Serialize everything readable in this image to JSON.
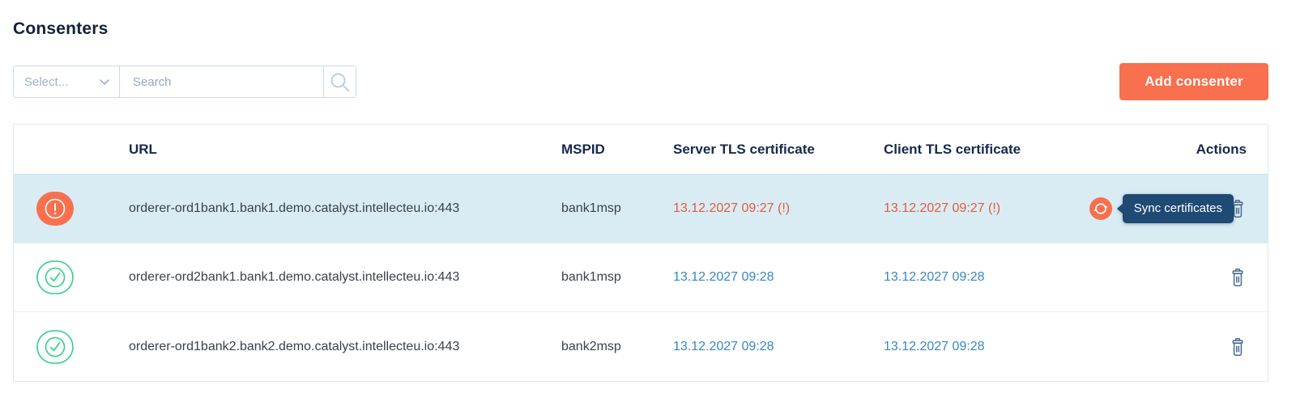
{
  "page": {
    "title": "Consenters"
  },
  "toolbar": {
    "select_value": "Select...",
    "search_placeholder": "Search",
    "add_button": "Add consenter"
  },
  "table": {
    "columns": {
      "url": "URL",
      "mspid": "MSPID",
      "server_cert": "Server TLS certificate",
      "client_cert": "Client TLS certificate",
      "actions": "Actions"
    },
    "rows": [
      {
        "status": "warning",
        "highlighted": true,
        "url": "orderer-ord1bank1.bank1.demo.catalyst.intellecteu.io:443",
        "mspid": "bank1msp",
        "server_cert": "13.12.2027 09:27 (!)",
        "client_cert": "13.12.2027 09:27 (!)",
        "tooltip": "Sync certificates"
      },
      {
        "status": "ok",
        "highlighted": false,
        "url": "orderer-ord2bank1.bank1.demo.catalyst.intellecteu.io:443",
        "mspid": "bank1msp",
        "server_cert": "13.12.2027 09:28",
        "client_cert": "13.12.2027 09:28"
      },
      {
        "status": "ok",
        "highlighted": false,
        "url": "orderer-ord1bank2.bank2.demo.catalyst.intellecteu.io:443",
        "mspid": "bank2msp",
        "server_cert": "13.12.2027 09:28",
        "client_cert": "13.12.2027 09:28"
      }
    ]
  },
  "icons": {
    "status_warning": "alert-circle-icon",
    "status_ok": "check-circle-icon",
    "select_chevron": "chevron-down-icon",
    "search": "magnifier-icon",
    "sync": "refresh-icon",
    "delete": "trash-icon"
  },
  "colors": {
    "accent_orange": "#F8704E",
    "row_highlight_blue": "#D9ECF4",
    "cert_warning_text": "#E25B3C",
    "cert_ok_text": "#3787C2",
    "status_ok_green": "#2ED089",
    "tooltip_navy": "#1E4A73",
    "heading_navy": "#15294B"
  }
}
